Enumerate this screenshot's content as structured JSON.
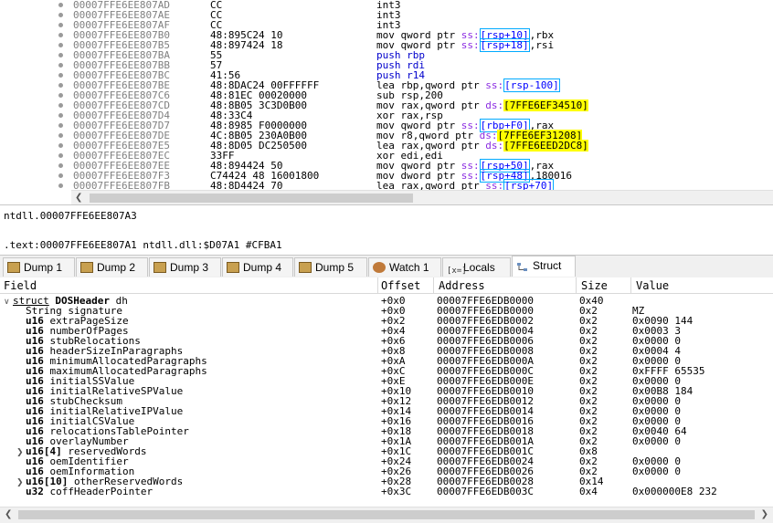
{
  "disasm": {
    "rows": [
      {
        "addr": "00007FFE6EE807AD",
        "bytes": "CC",
        "instr": [
          {
            "t": "int3"
          }
        ]
      },
      {
        "addr": "00007FFE6EE807AE",
        "bytes": "CC",
        "instr": [
          {
            "t": "int3"
          }
        ]
      },
      {
        "addr": "00007FFE6EE807AF",
        "bytes": "CC",
        "instr": [
          {
            "t": "int3"
          }
        ]
      },
      {
        "addr": "00007FFE6EE807B0",
        "bytes": "48:895C24 10",
        "instr": [
          {
            "t": "mov qword ptr "
          },
          {
            "t": "ss:",
            "c": "tag-ss"
          },
          {
            "t": "[rsp+10]",
            "c": "hl-c"
          },
          {
            "t": ",rbx"
          }
        ]
      },
      {
        "addr": "00007FFE6EE807B5",
        "bytes": "48:897424 18",
        "instr": [
          {
            "t": "mov qword ptr "
          },
          {
            "t": "ss:",
            "c": "tag-ss"
          },
          {
            "t": "[rsp+18]",
            "c": "hl-c"
          },
          {
            "t": ",rsi"
          }
        ]
      },
      {
        "addr": "00007FFE6EE807BA",
        "bytes": "55",
        "instr": [
          {
            "t": "push rbp",
            "c": "kw-push"
          }
        ]
      },
      {
        "addr": "00007FFE6EE807BB",
        "bytes": "57",
        "instr": [
          {
            "t": "push rdi",
            "c": "kw-push"
          }
        ]
      },
      {
        "addr": "00007FFE6EE807BC",
        "bytes": "41:56",
        "instr": [
          {
            "t": "push r14",
            "c": "kw-push"
          }
        ]
      },
      {
        "addr": "00007FFE6EE807BE",
        "bytes": "48:8DAC24 00FFFFFF",
        "instr": [
          {
            "t": "lea rbp,qword ptr "
          },
          {
            "t": "ss:",
            "c": "tag-ss"
          },
          {
            "t": "[rsp-100]",
            "c": "hl-c"
          }
        ]
      },
      {
        "addr": "00007FFE6EE807C6",
        "bytes": "48:81EC 00020000",
        "instr": [
          {
            "t": "sub rsp,200"
          }
        ]
      },
      {
        "addr": "00007FFE6EE807CD",
        "bytes": "48:8B05 3C3D0B00",
        "instr": [
          {
            "t": "mov rax,qword ptr "
          },
          {
            "t": "ds:",
            "c": "tag-ss"
          },
          {
            "t": "[7FFE6EF34510]",
            "c": "hl-y"
          }
        ]
      },
      {
        "addr": "00007FFE6EE807D4",
        "bytes": "48:33C4",
        "instr": [
          {
            "t": "xor rax,rsp"
          }
        ]
      },
      {
        "addr": "00007FFE6EE807D7",
        "bytes": "48:8985 F0000000",
        "instr": [
          {
            "t": "mov qword ptr "
          },
          {
            "t": "ss:",
            "c": "tag-ss"
          },
          {
            "t": "[rbp+F0]",
            "c": "hl-c"
          },
          {
            "t": ",rax"
          }
        ]
      },
      {
        "addr": "00007FFE6EE807DE",
        "bytes": "4C:8B05 230A0B00",
        "instr": [
          {
            "t": "mov r8,qword ptr "
          },
          {
            "t": "ds:",
            "c": "tag-ss"
          },
          {
            "t": "[7FFE6EF31208]",
            "c": "hl-y"
          }
        ]
      },
      {
        "addr": "00007FFE6EE807E5",
        "bytes": "48:8D05 DC250500",
        "instr": [
          {
            "t": "lea rax,qword ptr "
          },
          {
            "t": "ds:",
            "c": "tag-ss"
          },
          {
            "t": "[7FFE6EED2DC8]",
            "c": "hl-y"
          }
        ]
      },
      {
        "addr": "00007FFE6EE807EC",
        "bytes": "33FF",
        "instr": [
          {
            "t": "xor edi,edi"
          }
        ]
      },
      {
        "addr": "00007FFE6EE807EE",
        "bytes": "48:894424 50",
        "instr": [
          {
            "t": "mov qword ptr "
          },
          {
            "t": "ss:",
            "c": "tag-ss"
          },
          {
            "t": "[rsp+50]",
            "c": "hl-c"
          },
          {
            "t": ",rax"
          }
        ]
      },
      {
        "addr": "00007FFE6EE807F3",
        "bytes": "C74424 48 16001800",
        "instr": [
          {
            "t": "mov dword ptr "
          },
          {
            "t": "ss:",
            "c": "tag-ss"
          },
          {
            "t": "[rsp+48]",
            "c": "hl-c"
          },
          {
            "t": ",180016"
          }
        ]
      },
      {
        "addr": "00007FFE6EE807FB",
        "bytes": "48:8D4424 70",
        "instr": [
          {
            "t": "lea rax,qword ptr "
          },
          {
            "t": "ss:",
            "c": "tag-ss"
          },
          {
            "t": "[rsp+70]",
            "c": "hl-c"
          }
        ]
      }
    ]
  },
  "info": {
    "line1": "ntdll.00007FFE6EE807A3",
    "line2": ".text:00007FFE6EE807A1 ntdll.dll:$D07A1 #CFBA1"
  },
  "tabs": [
    {
      "label": "Dump 1",
      "icon": "dump-icon"
    },
    {
      "label": "Dump 2",
      "icon": "dump-icon"
    },
    {
      "label": "Dump 3",
      "icon": "dump-icon"
    },
    {
      "label": "Dump 4",
      "icon": "dump-icon"
    },
    {
      "label": "Dump 5",
      "icon": "dump-icon"
    },
    {
      "label": "Watch 1",
      "icon": "watch-icon"
    },
    {
      "label": "Locals",
      "icon": "locals-icon",
      "icon_text": "[x=]"
    },
    {
      "label": "Struct",
      "icon": "struct-icon",
      "active": true
    }
  ],
  "struct": {
    "headers": {
      "field": "Field",
      "offset": "Offset",
      "address": "Address",
      "size": "Size",
      "value": "Value"
    },
    "rows": [
      {
        "kw": "struct",
        "type": "DOSHeader",
        "name": "dh",
        "offset": "+0x0",
        "address": "00007FFE6EDB0000",
        "size": "0x40",
        "value": "",
        "expander": "open",
        "indent": 0
      },
      {
        "kw": "",
        "type": "String",
        "name": "signature",
        "offset": "+0x0",
        "address": "00007FFE6EDB0000",
        "size": "0x2",
        "value": "MZ",
        "indent": 1,
        "plain": true
      },
      {
        "type": "u16",
        "name": "extraPageSize",
        "offset": "+0x2",
        "address": "00007FFE6EDB0002",
        "size": "0x2",
        "value": "0x0090 144",
        "indent": 1
      },
      {
        "type": "u16",
        "name": "numberOfPages",
        "offset": "+0x4",
        "address": "00007FFE6EDB0004",
        "size": "0x2",
        "value": "0x0003 3",
        "indent": 1
      },
      {
        "type": "u16",
        "name": "stubRelocations",
        "offset": "+0x6",
        "address": "00007FFE6EDB0006",
        "size": "0x2",
        "value": "0x0000 0",
        "indent": 1
      },
      {
        "type": "u16",
        "name": "headerSizeInParagraphs",
        "offset": "+0x8",
        "address": "00007FFE6EDB0008",
        "size": "0x2",
        "value": "0x0004 4",
        "indent": 1
      },
      {
        "type": "u16",
        "name": "minimumAllocatedParagraphs",
        "offset": "+0xA",
        "address": "00007FFE6EDB000A",
        "size": "0x2",
        "value": "0x0000 0",
        "indent": 1
      },
      {
        "type": "u16",
        "name": "maximumAllocatedParagraphs",
        "offset": "+0xC",
        "address": "00007FFE6EDB000C",
        "size": "0x2",
        "value": "0xFFFF 65535",
        "indent": 1
      },
      {
        "type": "u16",
        "name": "initialSSValue",
        "offset": "+0xE",
        "address": "00007FFE6EDB000E",
        "size": "0x2",
        "value": "0x0000 0",
        "indent": 1
      },
      {
        "type": "u16",
        "name": "initialRelativeSPValue",
        "offset": "+0x10",
        "address": "00007FFE6EDB0010",
        "size": "0x2",
        "value": "0x00B8 184",
        "indent": 1
      },
      {
        "type": "u16",
        "name": "stubChecksum",
        "offset": "+0x12",
        "address": "00007FFE6EDB0012",
        "size": "0x2",
        "value": "0x0000 0",
        "indent": 1
      },
      {
        "type": "u16",
        "name": "initialRelativeIPValue",
        "offset": "+0x14",
        "address": "00007FFE6EDB0014",
        "size": "0x2",
        "value": "0x0000 0",
        "indent": 1
      },
      {
        "type": "u16",
        "name": "initialCSValue",
        "offset": "+0x16",
        "address": "00007FFE6EDB0016",
        "size": "0x2",
        "value": "0x0000 0",
        "indent": 1
      },
      {
        "type": "u16",
        "name": "relocationsTablePointer",
        "offset": "+0x18",
        "address": "00007FFE6EDB0018",
        "size": "0x2",
        "value": "0x0040 64",
        "indent": 1
      },
      {
        "type": "u16",
        "name": "overlayNumber",
        "offset": "+0x1A",
        "address": "00007FFE6EDB001A",
        "size": "0x2",
        "value": "0x0000 0",
        "indent": 1
      },
      {
        "type": "u16[4]",
        "name": "reservedWords",
        "offset": "+0x1C",
        "address": "00007FFE6EDB001C",
        "size": "0x8",
        "value": "",
        "indent": 1,
        "expander": "closed"
      },
      {
        "type": "u16",
        "name": "oemIdentifier",
        "offset": "+0x24",
        "address": "00007FFE6EDB0024",
        "size": "0x2",
        "value": "0x0000 0",
        "indent": 1
      },
      {
        "type": "u16",
        "name": "oemInformation",
        "offset": "+0x26",
        "address": "00007FFE6EDB0026",
        "size": "0x2",
        "value": "0x0000 0",
        "indent": 1
      },
      {
        "type": "u16[10]",
        "name": "otherReservedWords",
        "offset": "+0x28",
        "address": "00007FFE6EDB0028",
        "size": "0x14",
        "value": "",
        "indent": 1,
        "expander": "closed"
      },
      {
        "type": "u32",
        "name": "coffHeaderPointer",
        "offset": "+0x3C",
        "address": "00007FFE6EDB003C",
        "size": "0x4",
        "value": "0x000000E8 232",
        "indent": 1
      }
    ]
  }
}
